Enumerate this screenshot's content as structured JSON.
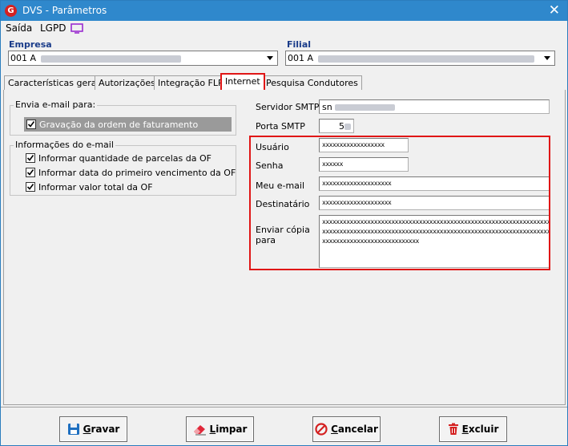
{
  "window": {
    "title": "DVS - Parâmetros",
    "app_icon_letter": "G"
  },
  "menu": {
    "items": [
      "Saída",
      "LGPD"
    ]
  },
  "empresa": {
    "label": "Empresa",
    "value_prefix": "001 A"
  },
  "filial": {
    "label": "Filial",
    "value_prefix": "001 A"
  },
  "tabs": [
    "Características gerais",
    "Autorizações",
    "Integração FLP",
    "Internet",
    "Pesquisa Condutores"
  ],
  "active_tab": "Internet",
  "envia_group": {
    "title": "Envia e-mail para:",
    "items": [
      {
        "label": "Gravação da ordem de faturamento",
        "checked": true
      }
    ]
  },
  "info_group": {
    "title": "Informações do e-mail",
    "items": [
      {
        "label": "Informar quantidade de parcelas da OF",
        "checked": true
      },
      {
        "label": "Informar data do primeiro vencimento da OF",
        "checked": true
      },
      {
        "label": "Informar valor total da OF",
        "checked": true
      }
    ]
  },
  "smtp": {
    "server_label": "Servidor SMTP",
    "server_value_prefix": "sn",
    "port_label": "Porta SMTP",
    "port_value": "5"
  },
  "email": {
    "usuario_label": "Usuário",
    "usuario_value": "xxxxxxxxxxxxxxxxxx",
    "senha_label": "Senha",
    "senha_value": "xxxxxx",
    "meu_email_label": "Meu e-mail",
    "meu_email_value": "xxxxxxxxxxxxxxxxxxxx",
    "destinatario_label": "Destinatário",
    "destinatario_value": "xxxxxxxxxxxxxxxxxxxx",
    "copia_label_line1": "Enviar cópia",
    "copia_label_line2": "para",
    "copia_lines": [
      "xxxxxxxxxxxxxxxxxxxxxxxxxxxxxxxxxxxxxxxxxxxxxxxxxxxxxxxxxxxxxxxxxx",
      "xxxxxxxxxxxxxxxxxxxxxxxxxxxxxxxxxxxxxxxxxxxxxxxxxxxxxxxxxxxxxxxxxx",
      "xxxxxxxxxxxxxxxxxxxxxxxxxxxx"
    ]
  },
  "buttons": {
    "gravar_first": "G",
    "gravar_rest": "ravar",
    "limpar_first": "L",
    "limpar_rest": "impar",
    "cancelar_first": "C",
    "cancelar_rest": "ancelar",
    "excluir_first": "E",
    "excluir_rest": "xcluir"
  },
  "colors": {
    "titlebar": "#2f88cc",
    "highlight": "#e01616",
    "label_blue": "#1a3c8a"
  }
}
